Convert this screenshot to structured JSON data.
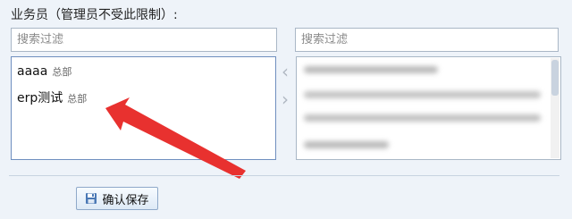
{
  "section": {
    "label": "业务员（管理员不受此限制）:"
  },
  "filters": {
    "left_placeholder": "搜索过滤",
    "right_placeholder": "搜索过滤"
  },
  "selected_list": [
    {
      "name": "aaaa",
      "dept": "总部"
    },
    {
      "name": "erp测试",
      "dept": "总部"
    }
  ],
  "transfer": {
    "left_icon": "chevron-left-icon",
    "right_icon": "chevron-right-icon"
  },
  "save_button": {
    "label": "确认保存",
    "icon": "floppy-disk-icon"
  },
  "annotation": {
    "color": "#e8312f",
    "icon": "red-arrow-icon"
  }
}
